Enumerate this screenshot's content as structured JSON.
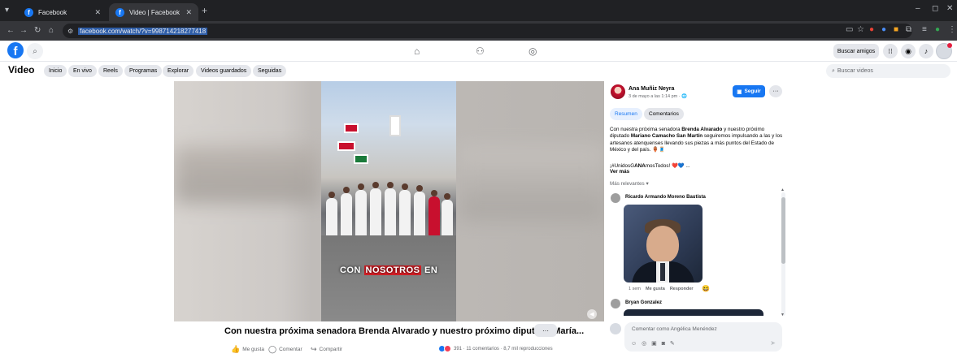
{
  "browser": {
    "tabs": [
      {
        "title": "Facebook",
        "active": false
      },
      {
        "title": "Video | Facebook",
        "active": true
      }
    ],
    "new_tab": "+",
    "url": "facebook.com/watch/?v=998714218277418",
    "window": {
      "minimize": "–",
      "maximize": "◻",
      "close": "✕"
    }
  },
  "fb_header": {
    "logo": "f",
    "find_friends": "Buscar amigos"
  },
  "subnav": {
    "title": "Video",
    "chips": [
      "Inicio",
      "En vivo",
      "Reels",
      "Programas",
      "Explorar",
      "Videos guardados",
      "Seguidas"
    ],
    "search_placeholder": "Buscar videos"
  },
  "video": {
    "caption_before": "CON",
    "caption_highlight": "NOSOTROS",
    "caption_after": "EN",
    "title": "Con nuestra próxima senadora Brenda Alvarado y nuestro próximo diputado María...",
    "more": "···",
    "actions": {
      "like": "Me gusta",
      "comment": "Comentar",
      "share": "Compartir"
    },
    "stats": "391 · 11 comentarios · 8,7 mil reproducciones"
  },
  "panel": {
    "author": "Ana Muñiz Neyra",
    "date": "3 de mayo a las 1:14 pm · 🌐",
    "follow": "Seguir",
    "more": "···",
    "tabs": [
      "Resumen",
      "Comentarios"
    ],
    "desc_1": "Con nuestra próxima senadora ",
    "desc_b1": "Brenda Alvarado",
    "desc_2": " y nuestro próximo diputado ",
    "desc_b2": "Mariano Camacho San Martín",
    "desc_3": " seguiremos impulsando a las y los artesanos atenquenses llevando sus piezas a más puntos del Estado de México y del país. 🏺🧵",
    "hashtags_1": "¡#UnidosG",
    "hashtags_b": "ANA",
    "hashtags_2": "mosTodos! ❤️💙 ...",
    "see_more": "Ver más",
    "relevant": "Más relevantes ▾",
    "comments": [
      {
        "name": "Ricardo Armando Moreno Bautista",
        "time": "1 sem",
        "like": "Me gusta",
        "reply": "Responder",
        "reaction": "😆"
      },
      {
        "name": "Bryan Gonzalez"
      }
    ],
    "composer_placeholder": "Comentar como Angélica Menéndez",
    "composer_tools": "☺ ◎ ▣ ◙ ✎",
    "send": "➤"
  },
  "colors": {
    "brand": "#1877f2",
    "highlight": "#d61f26"
  }
}
